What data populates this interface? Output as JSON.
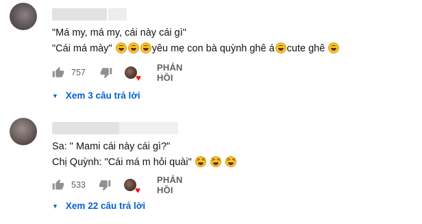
{
  "comments": [
    {
      "lines": [
        "\"Má my, má my, cái này cái gì\""
      ],
      "line2_segments": [
        "\"Cái má mày\" ",
        "yêu mẹ con bà quỳnh ghê á",
        "cute ghê "
      ],
      "likes": "757",
      "reply_label": "PHẢN HỒI",
      "view_replies": "Xem 3 câu trả lời"
    },
    {
      "lines": [
        "Sa: \" Mami cái này cái gì?\""
      ],
      "line2_segments": [
        "Chị Quỳnh: \"Cái má m hỏi quài\" "
      ],
      "likes": "533",
      "reply_label": "PHẢN HỒI",
      "view_replies": "Xem 22 câu trả lời"
    }
  ],
  "icons": {
    "emoji_a": "rolling-laughing-face",
    "emoji_b": "squinting-laughing-face",
    "like": "thumbs-up-icon",
    "dislike": "thumbs-down-icon",
    "creator_heart": "creator-heart-icon",
    "expand": "caret-down-icon"
  },
  "colors": {
    "link": "#065fd4",
    "meta": "#606060",
    "heart": "#ff0000"
  }
}
